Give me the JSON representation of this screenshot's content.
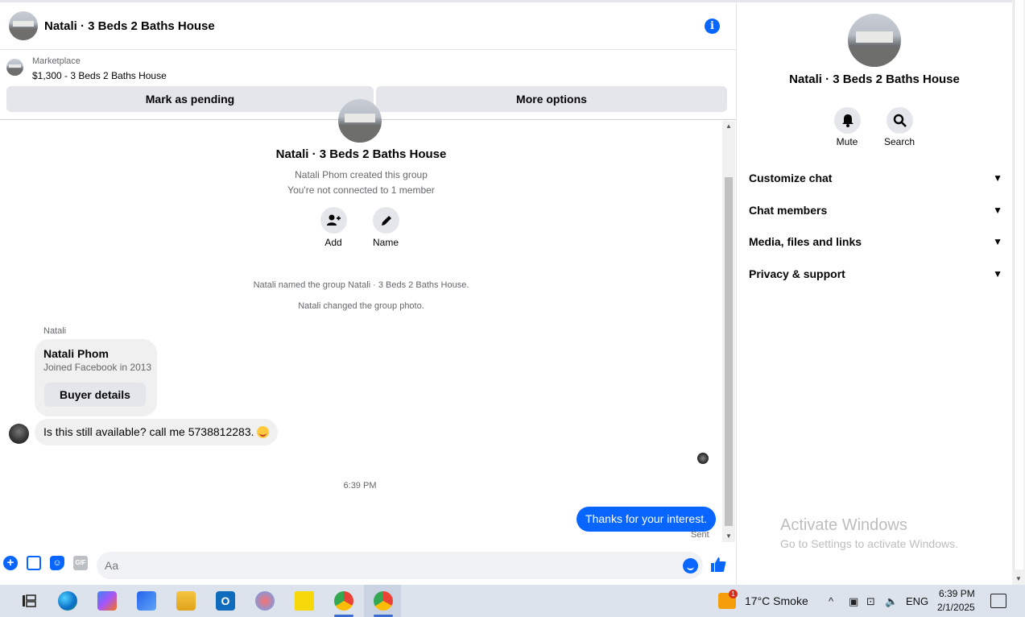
{
  "header": {
    "title": "Natali · 3 Beds 2 Baths House"
  },
  "marketplace": {
    "label": "Marketplace",
    "listing": "$1,300 - 3 Beds 2 Baths House",
    "pending_button": "Mark as pending",
    "more_button": "More options"
  },
  "group": {
    "name": "Natali · 3 Beds 2 Baths House",
    "created": "Natali Phom created this group",
    "connection": "You're not connected to 1 member",
    "add_label": "Add",
    "name_label": "Name",
    "sys_msg_1": "Natali named the group Natali · 3 Beds 2 Baths House.",
    "sys_msg_2": "Natali changed the group photo."
  },
  "messages": {
    "sender": "Natali",
    "card_name": "Natali Phom",
    "card_sub": "Joined Facebook in 2013",
    "card_button": "Buyer details",
    "incoming_text": "Is this still available? call me 5738812283.",
    "timestamp": "6:39 PM",
    "outgoing_text": "Thanks for your interest.",
    "sent_status": "Sent"
  },
  "composer": {
    "placeholder": "Aa",
    "gif_label": "GIF"
  },
  "info_panel": {
    "title": "Natali · 3 Beds 2 Baths House",
    "mute_label": "Mute",
    "search_label": "Search",
    "sections": [
      "Customize chat",
      "Chat members",
      "Media, files and links",
      "Privacy & support"
    ]
  },
  "watermark": {
    "line1": "Activate Windows",
    "line2": "Go to Settings to activate Windows."
  },
  "taskbar": {
    "weather_badge": "1",
    "weather": "17°C  Smoke",
    "language": "ENG",
    "time": "6:39 PM",
    "date": "2/1/2025"
  }
}
